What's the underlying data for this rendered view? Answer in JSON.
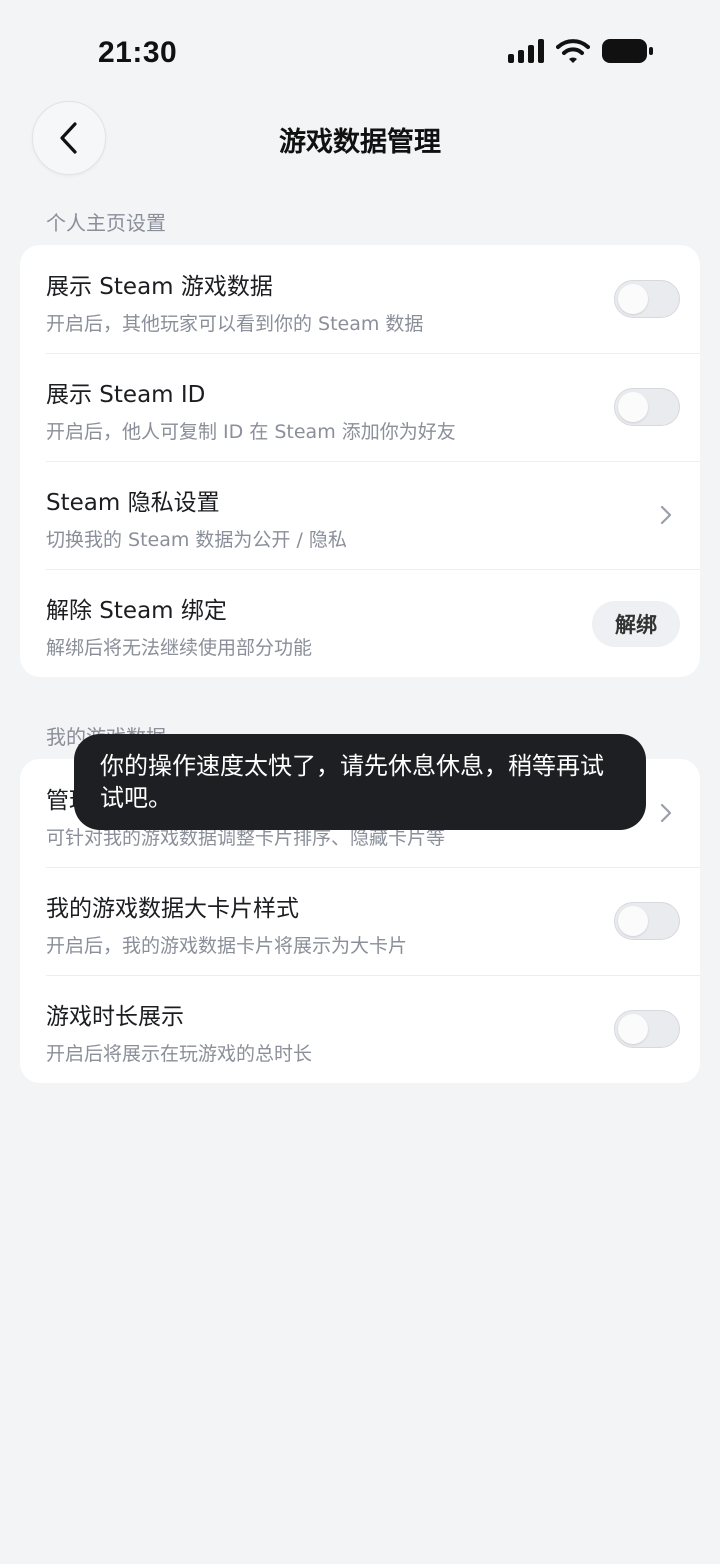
{
  "status_bar": {
    "time": "21:30",
    "icons": [
      "cellular-signal-icon",
      "wifi-icon",
      "battery-icon"
    ]
  },
  "header": {
    "title": "游戏数据管理",
    "back_icon": "chevron-left-icon"
  },
  "sections": [
    {
      "label": "个人主页设置",
      "rows": [
        {
          "title": "展示 Steam 游戏数据",
          "subtitle": "开启后，其他玩家可以看到你的 Steam 数据",
          "control": "toggle",
          "enabled": false
        },
        {
          "title": "展示 Steam ID",
          "subtitle": "开启后，他人可复制 ID 在 Steam 添加你为好友",
          "control": "toggle",
          "enabled": false
        },
        {
          "title": "Steam 隐私设置",
          "subtitle": "切换我的 Steam 数据为公开 / 隐私",
          "control": "chevron"
        },
        {
          "title": "解除 Steam 绑定",
          "subtitle": "解绑后将无法继续使用部分功能",
          "control": "button",
          "button_label": "解绑"
        }
      ]
    },
    {
      "label": "我的游戏数据",
      "rows": [
        {
          "title": "管理我的游戏数据",
          "subtitle": "可针对我的游戏数据调整卡片排序、隐藏卡片等",
          "control": "chevron"
        },
        {
          "title": "我的游戏数据大卡片样式",
          "subtitle": "开启后，我的游戏数据卡片将展示为大卡片",
          "control": "toggle",
          "enabled": false
        },
        {
          "title": "游戏时长展示",
          "subtitle": "开启后将展示在玩游戏的总时长",
          "control": "toggle",
          "enabled": false
        }
      ]
    }
  ],
  "toast": {
    "message": "你的操作速度太快了，请先休息休息，稍等再试试吧。"
  },
  "colors": {
    "background": "#f3f4f6",
    "card": "#ffffff",
    "toast": "#1e1f22",
    "secondary_text": "#8a8f99"
  }
}
